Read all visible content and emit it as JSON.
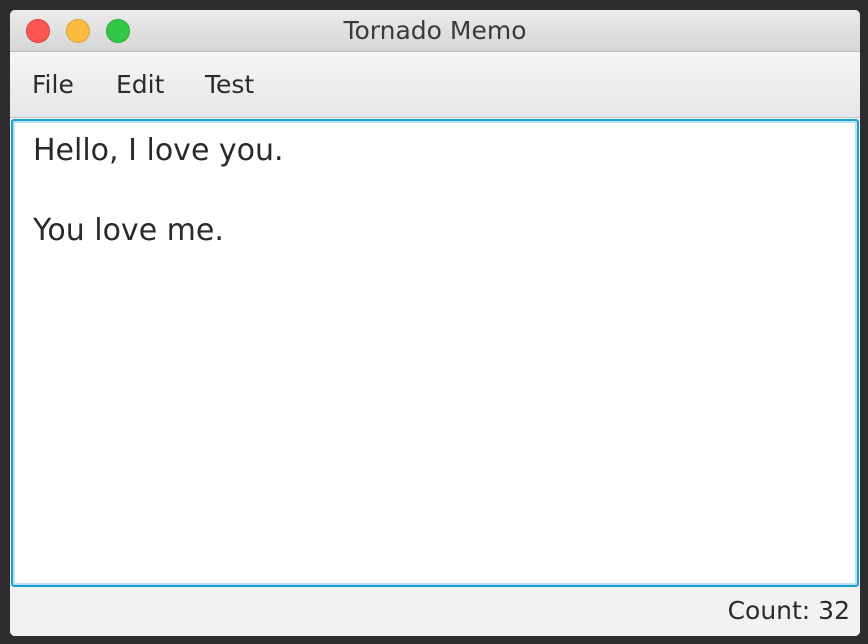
{
  "window": {
    "title": "Tornado Memo"
  },
  "menubar": {
    "items": [
      "File",
      "Edit",
      "Test"
    ]
  },
  "editor": {
    "content": "Hello, I love you.\n\nYou love me."
  },
  "statusbar": {
    "count_label": "Count: 32"
  },
  "colors": {
    "close": "#fc5753",
    "minimize": "#fdbc40",
    "maximize": "#33c748",
    "focus_border": "#1a9fd8"
  },
  "icons": {
    "close": "close-button",
    "minimize": "minimize-button",
    "maximize": "maximize-button"
  }
}
